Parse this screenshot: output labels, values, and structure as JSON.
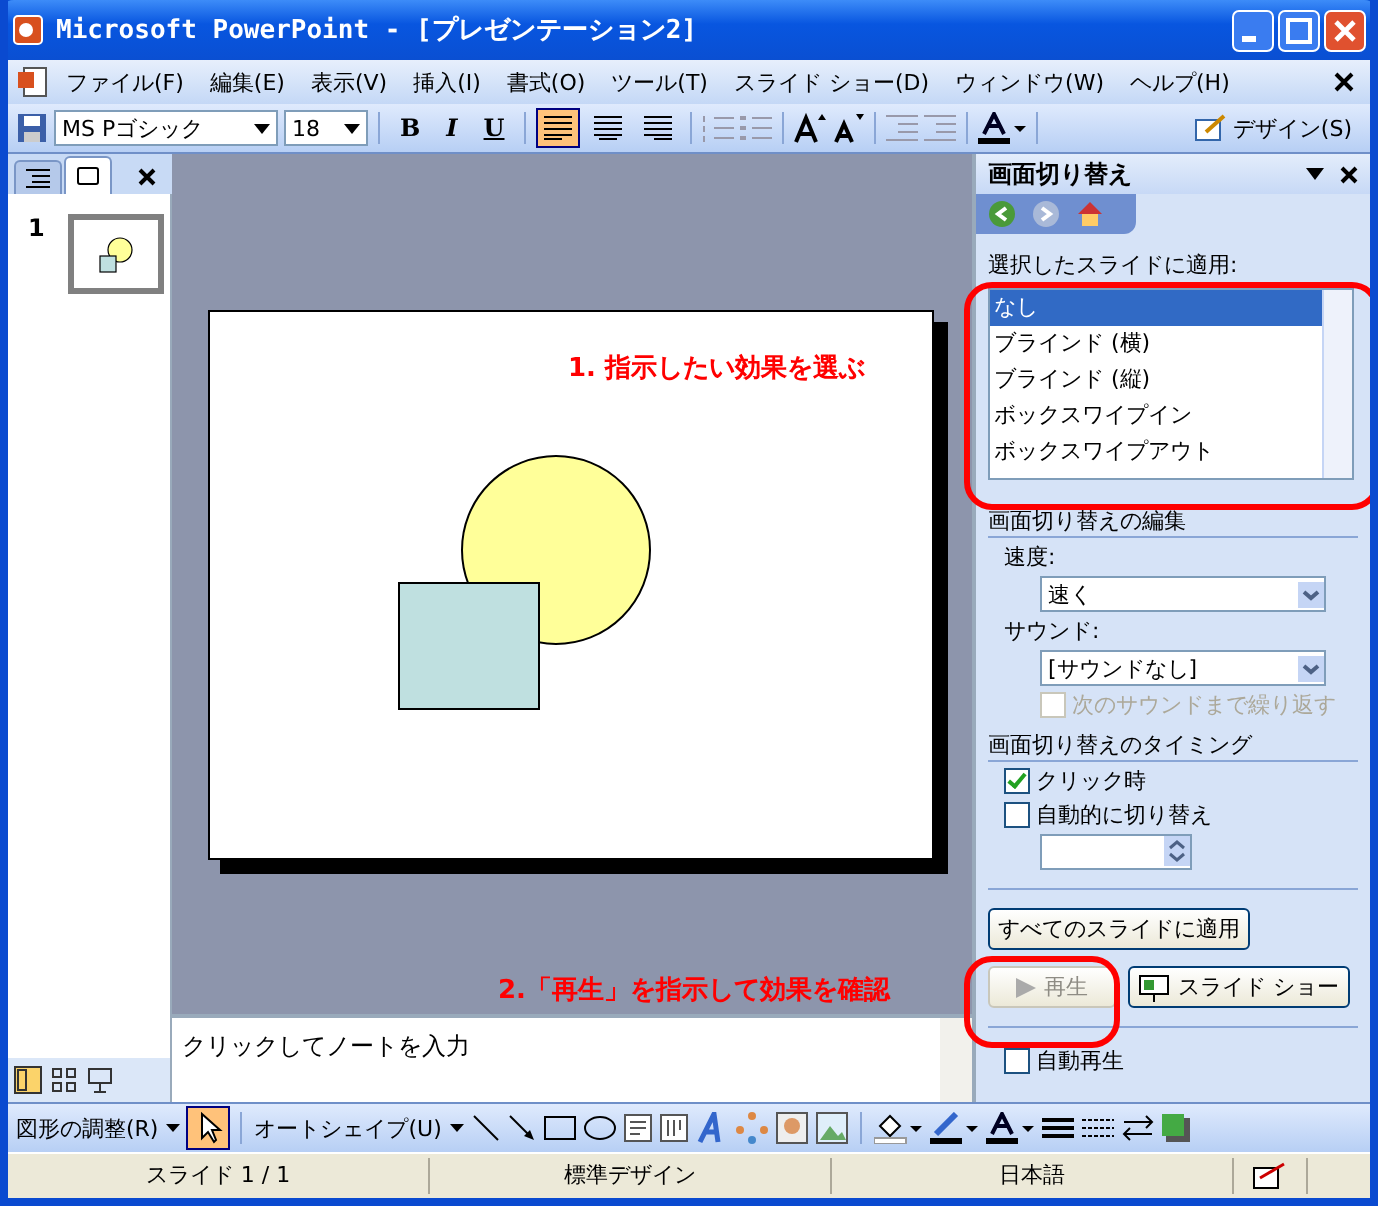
{
  "window": {
    "title": "Microsoft PowerPoint - [プレゼンテーション2]"
  },
  "menu": [
    "ファイル(F)",
    "編集(E)",
    "表示(V)",
    "挿入(I)",
    "書式(O)",
    "ツール(T)",
    "スライド ショー(D)",
    "ウィンドウ(W)",
    "ヘルプ(H)"
  ],
  "format_toolbar": {
    "font": "MS Pゴシック",
    "size": "18",
    "style_buttons": [
      "B",
      "I",
      "U"
    ],
    "align_buttons": [
      {
        "selected": true
      },
      {
        "selected": false
      },
      {
        "selected": false
      }
    ],
    "design_button": "デザイン(S)"
  },
  "left_pane": {
    "tabs": [
      {
        "selected": false
      },
      {
        "selected": true
      }
    ],
    "slide_number": "1"
  },
  "notes": {
    "text": "クリックしてノートを入力"
  },
  "annotations": [
    {
      "text": "1. 指示したい効果を選ぶ"
    },
    {
      "text": "2.「再生」を指示して効果を確認"
    }
  ],
  "task_pane": {
    "title": "画面切り替え",
    "apply_label": "選択したスライドに適用:",
    "transitions": [
      {
        "label": "なし",
        "selected": true
      },
      {
        "label": "ブラインド (横)",
        "selected": false
      },
      {
        "label": "ブラインド (縦)",
        "selected": false
      },
      {
        "label": "ボックスワイプイン",
        "selected": false
      },
      {
        "label": "ボックスワイプアウト",
        "selected": false
      }
    ],
    "edit_heading": "画面切り替えの編集",
    "speed_label": "速度:",
    "speed_value": "速く",
    "sound_label": "サウンド:",
    "sound_value": "[サウンドなし]",
    "loop_sound": {
      "label": "次のサウンドまで繰り返す",
      "checked": false,
      "disabled": true
    },
    "timing_heading": "画面切り替えのタイミング",
    "timing_options": [
      {
        "label": "クリック時",
        "checked": true,
        "disabled": false
      },
      {
        "label": "自動的に切り替え",
        "checked": false,
        "disabled": false
      }
    ],
    "apply_all_button": "すべてのスライドに適用",
    "play_button": {
      "label": "再生",
      "disabled": true
    },
    "slideshow_button": "スライド ショー",
    "autoplay": {
      "label": "自動再生",
      "checked": false,
      "disabled": false
    }
  },
  "drawing_toolbar": {
    "arrange": "図形の調整(R)",
    "pointer": {
      "selected": true
    },
    "autoshapes": "オートシェイプ(U)"
  },
  "status_bar": [
    "スライド 1 / 1",
    "標準デザイン",
    "日本語"
  ]
}
